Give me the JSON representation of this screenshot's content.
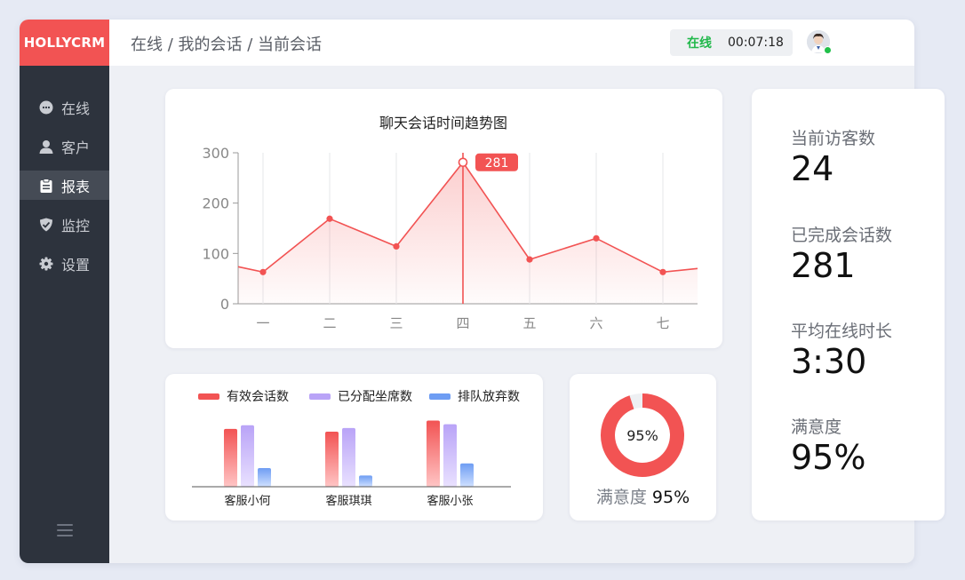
{
  "app": {
    "logo": "HOLLYCRM",
    "breadcrumb": "在线 / 我的会话 / 当前会话",
    "status": "在线",
    "timer": "00:07:18"
  },
  "sidebar": {
    "items": [
      {
        "label": "在线",
        "icon": "chat-bubble-icon",
        "active": false
      },
      {
        "label": "客户",
        "icon": "user-icon",
        "active": false
      },
      {
        "label": "报表",
        "icon": "clipboard-icon",
        "active": true
      },
      {
        "label": "监控",
        "icon": "shield-check-icon",
        "active": false
      },
      {
        "label": "设置",
        "icon": "gear-icon",
        "active": false
      }
    ]
  },
  "stats": [
    {
      "label": "当前访客数",
      "value": "24"
    },
    {
      "label": "已完成会话数",
      "value": "281"
    },
    {
      "label": "平均在线时长",
      "value": "3:30"
    },
    {
      "label": "满意度",
      "value": "95%"
    }
  ],
  "satisfaction": {
    "percent_label": "95%",
    "caption": "满意度",
    "caption_value": "95%",
    "fraction": 0.95
  },
  "colors": {
    "accent": "#f25353",
    "purple": "#b9a3f7",
    "blue": "#6e9df3",
    "online": "#21b84b"
  },
  "chart_data": [
    {
      "type": "area",
      "title": "聊天会话时间趋势图",
      "categories": [
        "一",
        "二",
        "三",
        "四",
        "五",
        "六",
        "七"
      ],
      "values": [
        63,
        169,
        114,
        281,
        88,
        130,
        63
      ],
      "ylim": [
        0,
        300
      ],
      "yticks": [
        0,
        100,
        200,
        300
      ],
      "highlight": {
        "index": 3,
        "label": "281"
      },
      "grid": true
    },
    {
      "type": "bar",
      "categories": [
        "客服小何",
        "客服琪琪",
        "客服小张"
      ],
      "series": [
        {
          "name": "有效会话数",
          "values": [
            62,
            59,
            71
          ]
        },
        {
          "name": "已分配坐席数",
          "values": [
            66,
            63,
            67
          ]
        },
        {
          "name": "排队放弃数",
          "values": [
            20,
            12,
            25
          ]
        }
      ],
      "legend": "top"
    }
  ]
}
